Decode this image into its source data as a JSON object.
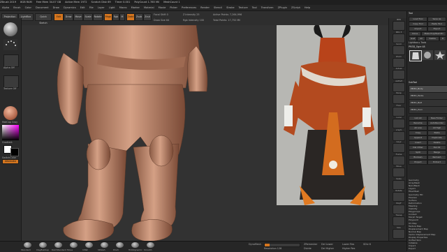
{
  "titlebar": [
    "ZBrush 2019",
    "8GB RAM",
    "Free Mem 34.07 GB",
    "Active Mem 1972",
    "Scratch Disk 69",
    "Timer 0.001",
    "PolyCount 1.785 Mil",
    "MeshCount 1"
  ],
  "menubar": [
    "Alpha",
    "Brush",
    "Color",
    "Document",
    "Draw",
    "Dynamics",
    "Edit",
    "File",
    "Layer",
    "Light",
    "Macro",
    "Marker",
    "Material",
    "Movie",
    "Picker",
    "Preferences",
    "Render",
    "Stencil",
    "Stroke",
    "Texture",
    "Tool",
    "Transform",
    "ZPlugin",
    "ZScript",
    "Help"
  ],
  "topshelf": {
    "projection": "Projection Master",
    "lightbox": "LightBox",
    "quicksketch": "Quick Sketch",
    "edit": "Edit",
    "draw": "Draw",
    "move": "Move",
    "scale": "Scale",
    "rotate": "Rotate",
    "mrgb": "Mrgb",
    "rgb": "Rgb",
    "m": "M",
    "zadd": "Zadd",
    "zsub": "Zsub",
    "zcut": "Zcut",
    "focal_shift": "Focal Shift 0",
    "draw_size": "Draw Size 64",
    "z_intensity": "Z Intensity 25",
    "rgb_intensity": "Rgb Intensity 100",
    "active_points": "Active Points: 7,264,996",
    "total_points": "Total Points: 17,752 Mil"
  },
  "leftpanel": {
    "alpha_label": "Alpha Off",
    "texture_label": "Texture Off",
    "material_label": "MatCap Gray",
    "gradient_label": "Gradient",
    "switch_label": "SwitchColor",
    "alternate": "Alternate"
  },
  "rightstrip": [
    "BPR",
    "SPix 3",
    "Scroll",
    "Zoom",
    "Actual",
    "AAHalf",
    "Persp",
    "Floor",
    "Local",
    "L.Sym",
    "Gxyz",
    "Frame",
    "Move",
    "Scale",
    "Rotate",
    "PolyF",
    "Transp",
    "Solo"
  ],
  "rightpanel": {
    "title": "Tool",
    "load": "Load Tool",
    "save": "Save As",
    "copy": "Copy Tool",
    "paste": "Paste Tool",
    "import": "Import",
    "export": "Export",
    "clone": "Clone",
    "make_polymesh": "Make PolyMesh3D",
    "goz": "GoZ",
    "all": "All",
    "visible": "Visible",
    "r": "R",
    "lightbox_tools": "Lightbox ▸ Tools",
    "tool_name": "PM3D_Ogre 48",
    "subtool_header": "SubTool",
    "subtool_items": [
      "PM3D_Body",
      "PM3D_Pants",
      "PM3D_Belt",
      "PM3D_Horn"
    ],
    "list_all": "List All",
    "new_folder": "New Folder",
    "buttons": [
      "Rename",
      "AutoReorder",
      "All Low",
      "All High",
      "Copy",
      "Paste",
      "Append",
      "Duplicate",
      "Insert",
      "Delete",
      "Del Other",
      "Del All",
      "Split",
      "Merge",
      "Boolean",
      "Remesh",
      "Project",
      "Extract"
    ],
    "lower_items": [
      "Geometry",
      "ArrayMesh",
      "NanoMesh",
      "Layers",
      "FiberMesh",
      "Geometry HD",
      "Preview",
      "Surface",
      "Deformation",
      "Masking",
      "Visibility",
      "Polygroups",
      "Contact",
      "Morph Target",
      "Polypaint",
      "UV Map",
      "Texture Map",
      "Displacement Map",
      "Normal Map",
      "Vector Displacement Map",
      "Display Properties",
      "Unified Skin",
      "Initialize",
      "Import",
      "Export"
    ]
  },
  "bottombar": {
    "brushes": [
      "Standard",
      "ClayBuildup",
      "DamStandard",
      "Move",
      "Inflat",
      "hPolish",
      "Pinch",
      "TrimDynamic",
      "Smooth"
    ],
    "dynamesh": "DynaMesh",
    "resolution": "Resolution 128",
    "zremesher": "ZRemesher",
    "divide": "Divide",
    "del_lower": "Del Lower",
    "del_higher": "Del Higher",
    "lower_res": "Lower Res",
    "higher_res": "Higher Res",
    "sdiv": "SDiv 6"
  },
  "colors": {
    "accent": "#d5761f",
    "skin": "#c08a6e",
    "ogre": "#b34a1f"
  }
}
